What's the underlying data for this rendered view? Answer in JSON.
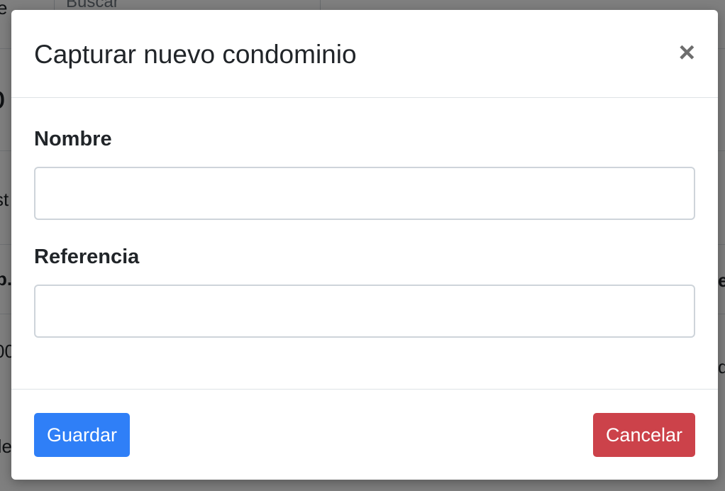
{
  "background": {
    "search_placeholder": "Buscar",
    "fragments": [
      "e",
      "o",
      "st",
      "p.",
      "00",
      "de",
      "e",
      "d"
    ]
  },
  "modal": {
    "title": "Capturar nuevo condominio",
    "close_icon": "×",
    "fields": [
      {
        "label": "Nombre",
        "value": "",
        "placeholder": ""
      },
      {
        "label": "Referencia",
        "value": "",
        "placeholder": ""
      }
    ],
    "save_label": "Guardar",
    "cancel_label": "Cancelar"
  }
}
